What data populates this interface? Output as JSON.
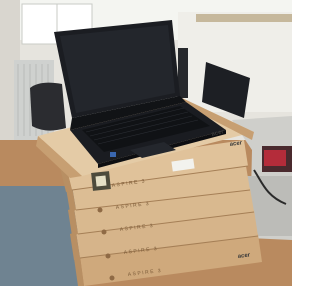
{
  "photo": {
    "subject": "laptop-on-stacked-boxes",
    "lid_brand": "acer",
    "box_brand": "acer",
    "box_model": "ASPIRE 3",
    "box_count": 5,
    "colors": {
      "wall": "#e9e8e3",
      "window_light": "#f6f7f3",
      "floor": "#b98a5f",
      "carpet": "#6f8391",
      "laptop": "#1b1d22",
      "keyboard": "#101215",
      "cardboard": "#d6b48a",
      "cardboard_dark": "#b88f63"
    }
  }
}
